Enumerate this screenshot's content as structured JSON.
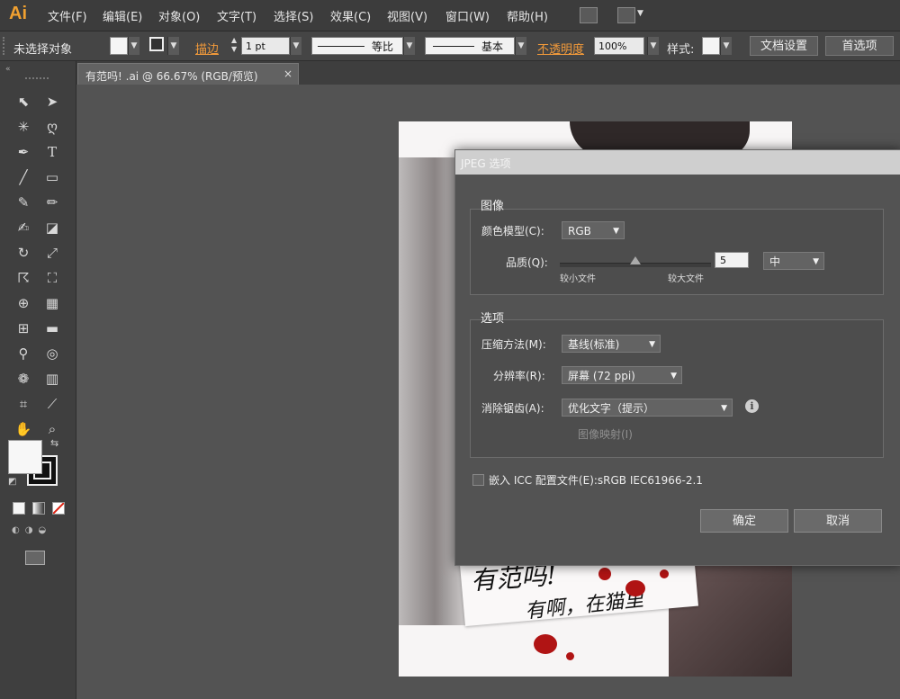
{
  "app": {
    "logo": "Ai"
  },
  "menu": [
    "文件(F)",
    "编辑(E)",
    "对象(O)",
    "文字(T)",
    "选择(S)",
    "效果(C)",
    "视图(V)",
    "窗口(W)",
    "帮助(H)"
  ],
  "control_bar": {
    "selection": "未选择对象",
    "stroke_label": "描边",
    "stroke_weight": "1 pt",
    "profile_1": "等比",
    "profile_2": "基本",
    "opacity_label": "不透明度",
    "opacity_value": "100%",
    "style_label": "样式:",
    "doc_setup_button": "文档设置",
    "prefs_button": "首选项"
  },
  "document_tab": {
    "title": "有范吗! .ai @ 66.67% (RGB/预览)",
    "close": "×"
  },
  "dialog": {
    "title": "JPEG 选项",
    "image_group": {
      "label": "图像",
      "color_model_label": "颜色模型(C):",
      "color_model_value": "RGB",
      "quality_label": "品质(Q):",
      "quality_value": "5",
      "quality_level": "中",
      "smaller_file": "较小文件",
      "larger_file": "较大文件"
    },
    "options_group": {
      "label": "选项",
      "compression_label": "压缩方法(M):",
      "compression_value": "基线(标准)",
      "resolution_label": "分辨率(R):",
      "resolution_value": "屏幕 (72 ppi)",
      "antialias_label": "消除锯齿(A):",
      "antialias_value": "优化文字（提示）",
      "image_map": "图像映射(I)"
    },
    "icc": {
      "label": "嵌入 ICC 配置文件(E):sRGB IEC61966-2.1",
      "checked": false
    },
    "ok_button": "确定",
    "cancel_button": "取消"
  },
  "artwork": {
    "line1": "有范吗!",
    "line2": "有啊，在猫里"
  },
  "colors": {
    "accent": "#f29a3a",
    "blood": "#b01414"
  }
}
